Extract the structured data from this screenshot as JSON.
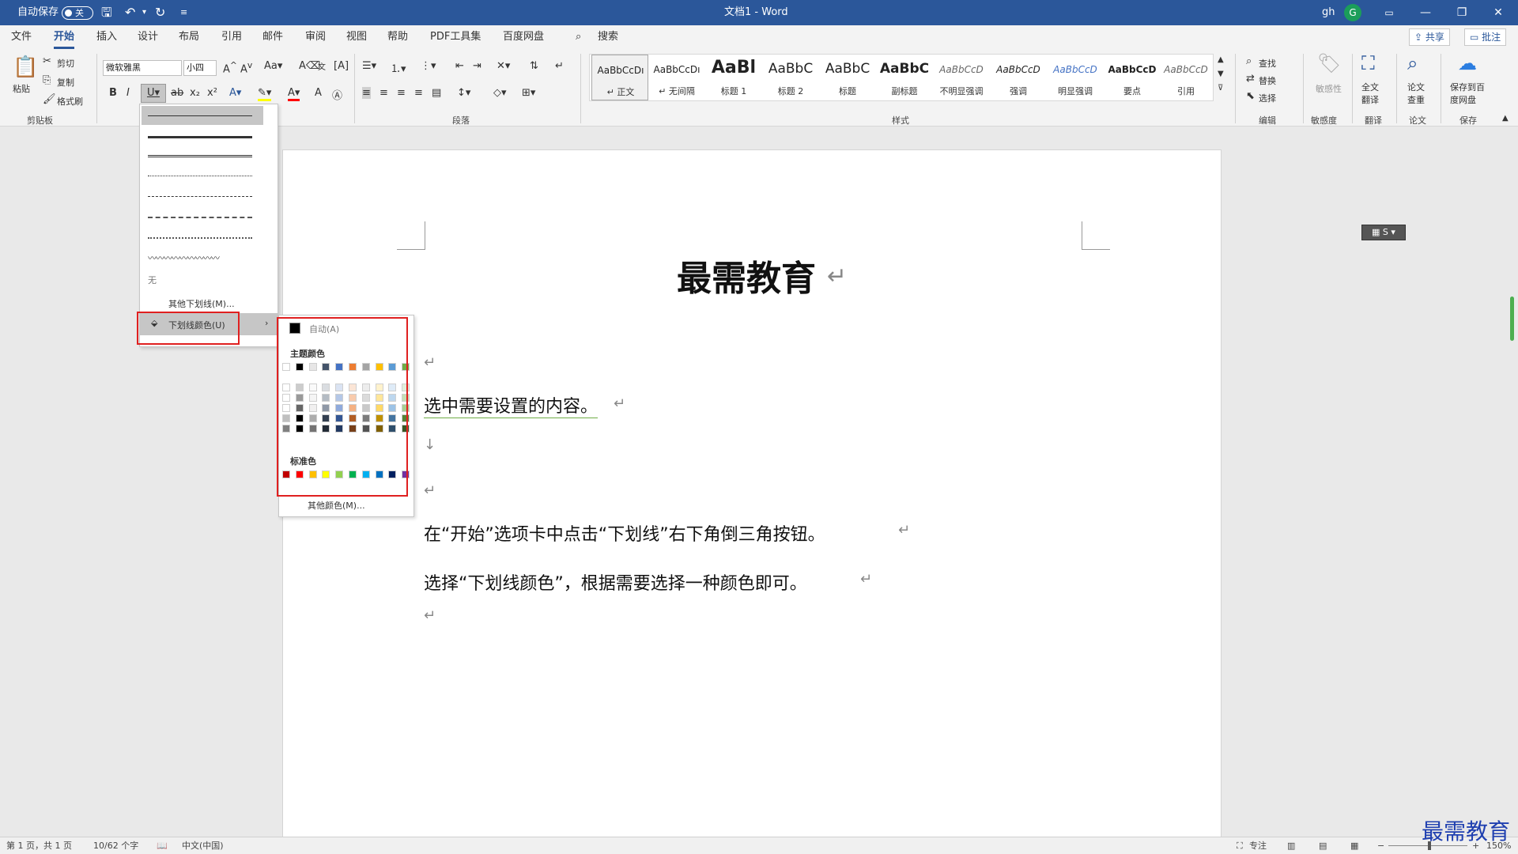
{
  "titlebar": {
    "autosave_label": "自动保存",
    "autosave_state": "关",
    "doc_title": "文档1  -  Word",
    "user_name": "gh",
    "user_initial": "G"
  },
  "tabs": [
    "文件",
    "开始",
    "插入",
    "设计",
    "布局",
    "引用",
    "邮件",
    "审阅",
    "视图",
    "帮助",
    "PDF工具集",
    "百度网盘"
  ],
  "search_label": "搜索",
  "top_buttons": {
    "share": "共享",
    "comment": "批注"
  },
  "ribbon": {
    "clipboard": {
      "paste": "粘贴",
      "cut": "剪切",
      "copy": "复制",
      "format_painter": "格式刷",
      "label": "剪贴板"
    },
    "font": {
      "name": "微软雅黑",
      "size": "小四"
    },
    "paragraph_label": "段落",
    "styles_label": "样式",
    "styles": [
      {
        "sample": "AaBbCcDı",
        "name": "↵ 正文"
      },
      {
        "sample": "AaBbCcDı",
        "name": "↵ 无间隔"
      },
      {
        "sample": "AaBl",
        "name": "标题 1"
      },
      {
        "sample": "AaBbC",
        "name": "标题 2"
      },
      {
        "sample": "AaBbC",
        "name": "标题"
      },
      {
        "sample": "AaBbC",
        "name": "副标题"
      },
      {
        "sample": "AaBbCcD",
        "name": "不明显强调"
      },
      {
        "sample": "AaBbCcD",
        "name": "强调"
      },
      {
        "sample": "AaBbCcD",
        "name": "明显强调"
      },
      {
        "sample": "AaBbCcD",
        "name": "要点"
      },
      {
        "sample": "AaBbCcD",
        "name": "引用"
      }
    ],
    "editing": {
      "find": "查找",
      "replace": "替换",
      "select": "选择",
      "label": "编辑"
    },
    "sensitivity": {
      "btn": "敏感性",
      "label": "敏感度"
    },
    "translate": {
      "btn": "全文翻译",
      "label": "翻译"
    },
    "paper": {
      "btn": "论文查重",
      "label": "论文"
    },
    "save": {
      "btn": "保存到百度网盘",
      "label": "保存"
    }
  },
  "underline_menu": {
    "none": "无",
    "more": "其他下划线(M)...",
    "color": "下划线颜色(U)"
  },
  "color_menu": {
    "auto": "自动(A)",
    "theme_label": "主题颜色",
    "standard_label": "标准色",
    "more": "其他颜色(M)...",
    "theme_top": [
      "#ffffff",
      "#000000",
      "#e7e6e6",
      "#44546a",
      "#4472c4",
      "#ed7d31",
      "#a5a5a5",
      "#ffc000",
      "#5b9bd5",
      "#70ad47"
    ],
    "standard": [
      "#c00000",
      "#ff0000",
      "#ffc000",
      "#ffff00",
      "#92d050",
      "#00b050",
      "#00b0f0",
      "#0070c0",
      "#002060",
      "#7030a0"
    ]
  },
  "document": {
    "title": "最需教育",
    "line1": "选中需要设置的内容。",
    "line2": "在“开始”选项卡中点击“下划线”右下角倒三角按钮。",
    "line3": "选择“下划线颜色”，根据需要选择一种颜色即可。"
  },
  "statusbar": {
    "page": "第 1 页，共 1 页",
    "words": "10/62 个字",
    "lang": "中文(中国)",
    "focus": "专注",
    "zoom": "150%"
  },
  "watermark": "最需教育"
}
